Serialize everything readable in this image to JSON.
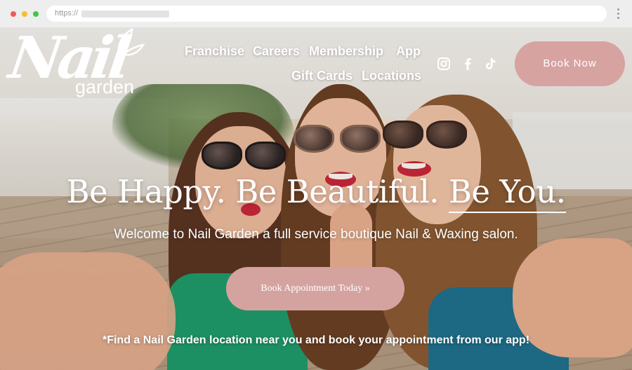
{
  "browser": {
    "url_prefix": "https://"
  },
  "logo": {
    "word": "Nail",
    "sub": "garden"
  },
  "nav": {
    "items": [
      "Franchise",
      "Careers",
      "Membership",
      "App",
      "Gift Cards",
      "Locations"
    ]
  },
  "social": {
    "icons": [
      "instagram-icon",
      "facebook-icon",
      "tiktok-icon"
    ]
  },
  "cta": {
    "book_now": "Book Now",
    "book_appointment": "Book Appointment Today »"
  },
  "hero": {
    "headline_part1": "Be Happy. Be Beautiful. ",
    "headline_part2": "Be You.",
    "tagline": "Welcome to Nail Garden a full service boutique Nail & Waxing salon.",
    "footnote": "*Find a Nail Garden location near you and book your appointment from our app!"
  },
  "colors": {
    "accent_pink": "#d6a3a1",
    "text_white": "#ffffff"
  }
}
